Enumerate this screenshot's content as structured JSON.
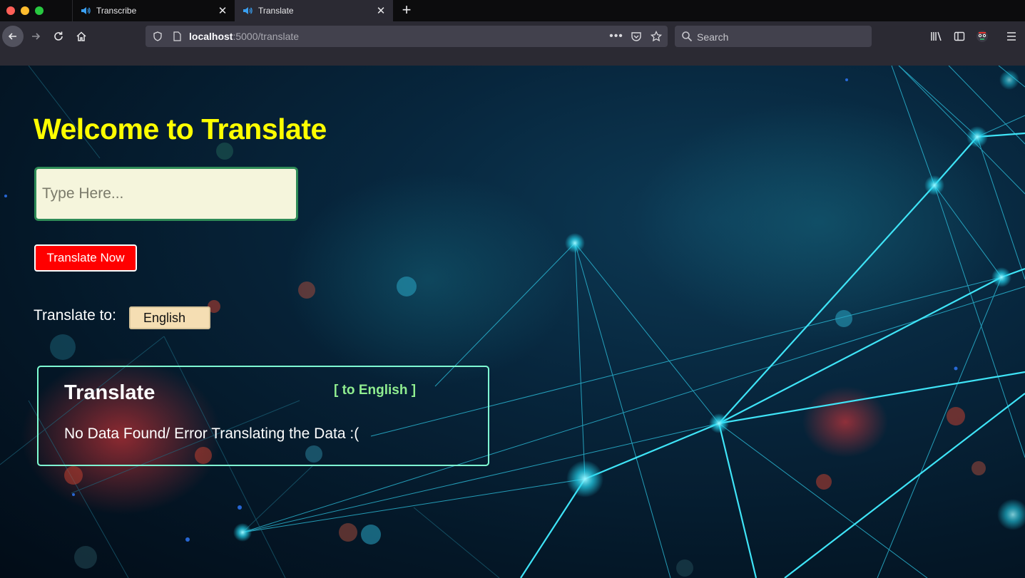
{
  "browser": {
    "tabs": [
      {
        "label": "Transcribe",
        "active": false
      },
      {
        "label": "Translate",
        "active": true
      }
    ],
    "url_host": "localhost",
    "url_path": ":5000/translate",
    "search_placeholder": "Search"
  },
  "page": {
    "heading": "Welcome to Translate",
    "input_placeholder": "Type Here...",
    "translate_button": "Translate Now",
    "translate_to_label": "Translate to:",
    "selected_language": "English",
    "result": {
      "title": "Translate",
      "target": "[ to English ]",
      "message": "No Data Found/ Error Translating the Data :("
    }
  },
  "colors": {
    "heading": "#ffff00",
    "button": "#ff0000",
    "input_bg": "#f5f5dc",
    "input_border": "#2e8b57",
    "select_bg": "#f5deb3",
    "result_border": "#7fffd4",
    "result_target": "#90ee90"
  },
  "icons": [
    "speaker-icon",
    "close-icon",
    "plus-icon",
    "back-arrow-icon",
    "forward-arrow-icon",
    "reload-icon",
    "home-icon",
    "shield-icon",
    "page-icon",
    "more-dots-icon",
    "pocket-icon",
    "star-icon",
    "search-icon",
    "library-icon",
    "sidebar-icon",
    "account-icon",
    "menu-icon"
  ]
}
